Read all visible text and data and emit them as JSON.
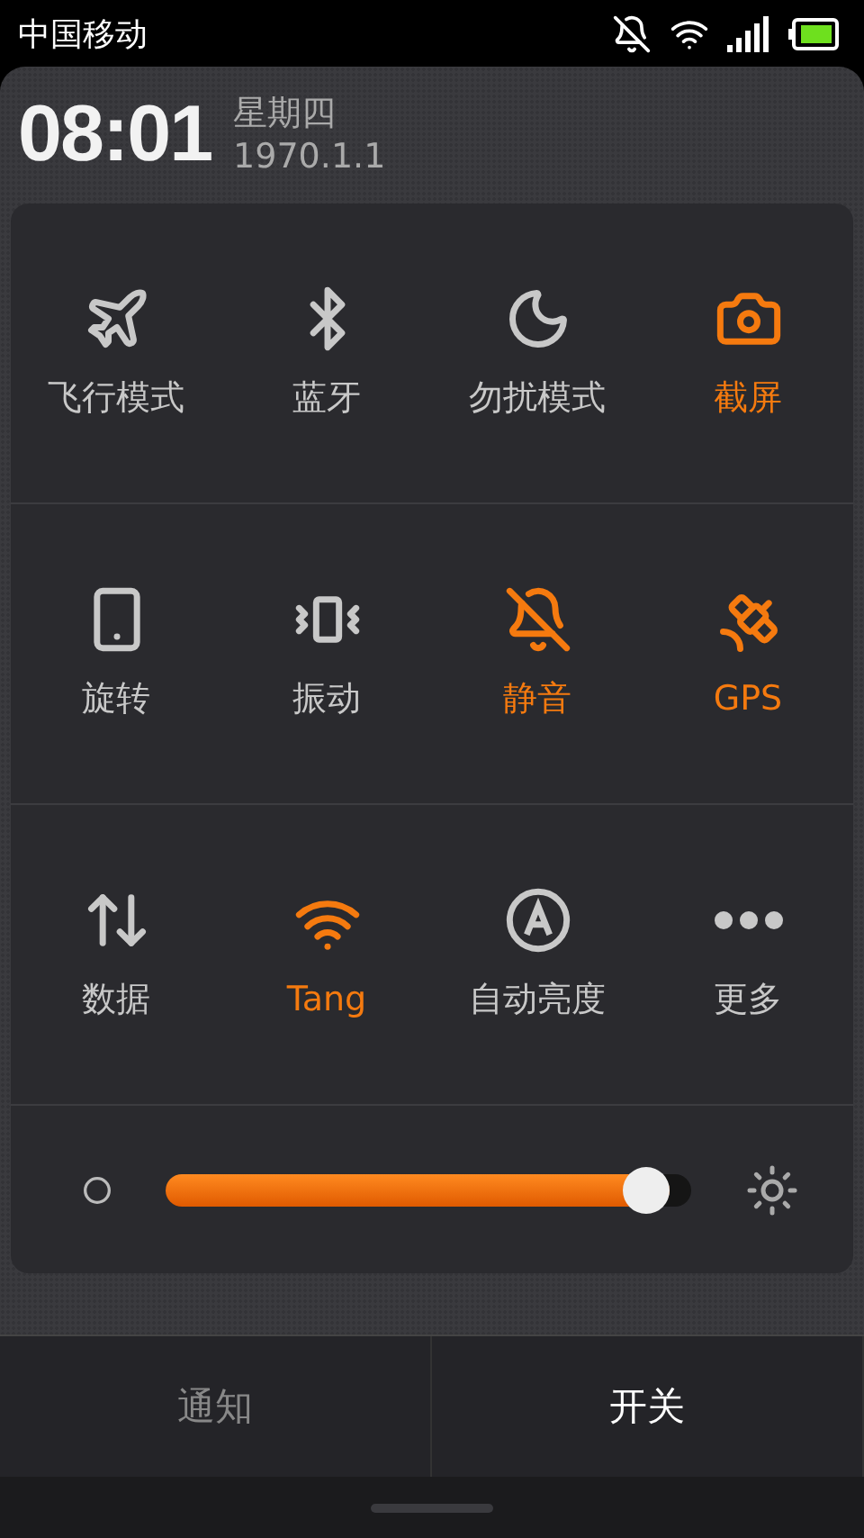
{
  "status_bar": {
    "carrier": "中国移动"
  },
  "header": {
    "time": "08:01",
    "weekday": "星期四",
    "date": "1970.1.1"
  },
  "toggles": [
    {
      "label": "飞行模式",
      "on": false
    },
    {
      "label": "蓝牙",
      "on": false
    },
    {
      "label": "勿扰模式",
      "on": false
    },
    {
      "label": "截屏",
      "on": true
    },
    {
      "label": "旋转",
      "on": false
    },
    {
      "label": "振动",
      "on": false
    },
    {
      "label": "静音",
      "on": true
    },
    {
      "label": "GPS",
      "on": true
    },
    {
      "label": "数据",
      "on": false
    },
    {
      "label": "Tang",
      "on": true
    },
    {
      "label": "自动亮度",
      "on": false
    },
    {
      "label": "更多",
      "on": false
    }
  ],
  "brightness": {
    "level": 0.96
  },
  "tabs": [
    {
      "label": "通知",
      "selected": false
    },
    {
      "label": "开关",
      "selected": true
    }
  ]
}
